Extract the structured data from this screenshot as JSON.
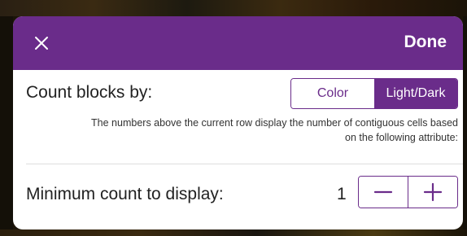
{
  "header": {
    "close_icon": "close-icon",
    "done_label": "Done"
  },
  "count_blocks": {
    "label": "Count blocks by:",
    "options": [
      "Color",
      "Light/Dark"
    ],
    "selected": "Light/Dark",
    "description": "The numbers above the current row display the number of contiguous cells based on the following attribute:"
  },
  "min_count": {
    "label": "Minimum count to display:",
    "value": "1",
    "decrement_icon": "minus-icon",
    "increment_icon": "plus-icon"
  },
  "colors": {
    "accent": "#6a2c8a",
    "background": "#ffffff"
  }
}
